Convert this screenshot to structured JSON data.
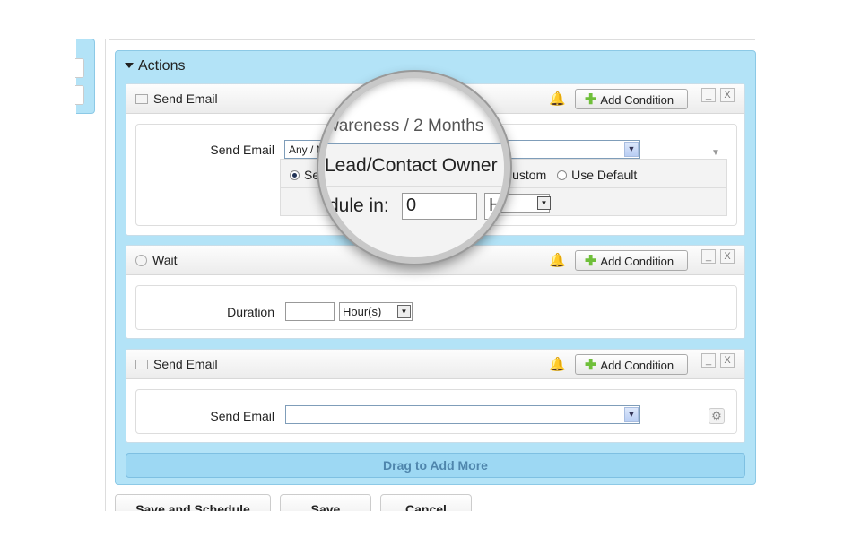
{
  "actions": {
    "title": "Actions",
    "cards": [
      {
        "type": "Send Email",
        "add_condition": "Add Condition",
        "minimize": "_",
        "close": "X",
        "field_label": "Send Email",
        "select_value": "Any / M",
        "radio_options": [
          {
            "label": "Se",
            "selected": true
          },
          {
            "label": "Custom",
            "selected": false
          },
          {
            "label": "Use Default",
            "selected": false
          }
        ],
        "schedule_value": "0",
        "schedule_unit": "H"
      },
      {
        "type": "Wait",
        "add_condition": "Add Condition",
        "minimize": "_",
        "close": "X",
        "field_label": "Duration",
        "duration_value": "",
        "unit_value": "Hour(s)"
      },
      {
        "type": "Send Email",
        "add_condition": "Add Condition",
        "minimize": "_",
        "close": "X",
        "field_label": "Send Email",
        "select_value": ""
      }
    ],
    "drag_label": "Drag to Add More"
  },
  "magnifier": {
    "line1": "wareness / 2 Months",
    "line2": "Lead/Contact Owner",
    "line3": "dule in:",
    "input_value": "0",
    "unit": "H"
  },
  "footer": {
    "save_schedule": "Save and Schedule",
    "save": "Save",
    "cancel": "Cancel"
  },
  "colors": {
    "panel": "#b3e3f7",
    "drag_bar": "#9dd8f3",
    "accent_plus": "#6fbf3a"
  }
}
